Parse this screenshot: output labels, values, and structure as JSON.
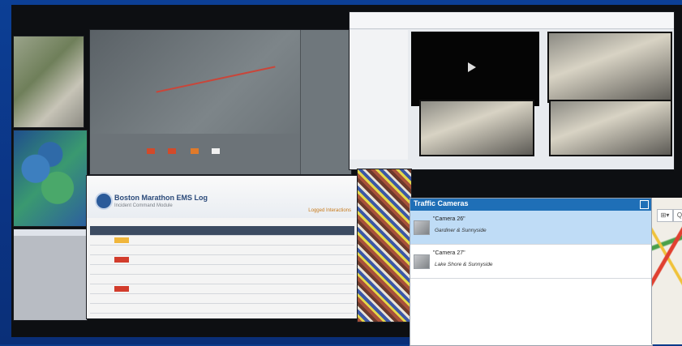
{
  "wall": {
    "report": {
      "title": "Boston Marathon EMS Log",
      "subtitle": "Incident Command Module",
      "tag": "Logged Interactions"
    }
  },
  "traffic_cameras": {
    "title": "Traffic Cameras",
    "cameras": [
      {
        "name": "\"Camera 26\"",
        "location": "Gardiner & Sunnyside",
        "selected": true
      },
      {
        "name": "\"Camera 27\"",
        "location": "Lake Shore & Sunnyside",
        "selected": false
      }
    ],
    "colors": {
      "header": "#1f6fb7",
      "selected_row": "#bfdcf6"
    }
  },
  "map_panel": {
    "grid_icon": "grid-icon",
    "grid_label": "⊞▾",
    "search_label": "Q"
  }
}
